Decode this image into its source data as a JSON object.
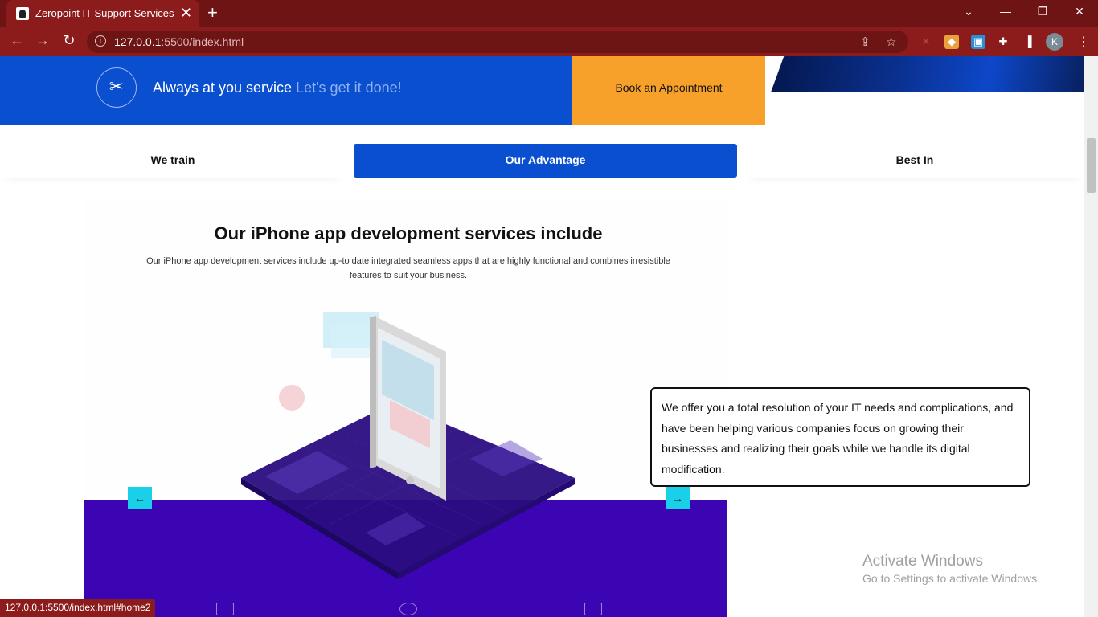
{
  "browser": {
    "tab_title": "Zeropoint IT Support Services",
    "tab_close": "✕",
    "new_tab": "+",
    "url_host": "127.0.0.1",
    "url_rest": ":5500/index.html",
    "status_url": "127.0.0.1:5500/index.html#home2",
    "profile_initial": "K"
  },
  "header": {
    "service_main": "Always at you service",
    "service_accent": "Let's get it done!",
    "book_label": "Book an Appointment"
  },
  "tabs": {
    "left": "We train",
    "middle": "Our Advantage",
    "right": "Best In"
  },
  "section": {
    "title": "Our iPhone app development services include",
    "description": "Our iPhone app development services include up-to date integrated seamless apps that are highly functional and combines irresistible features to suit your business."
  },
  "info_box": {
    "text": "We offer you a total resolution of your IT needs and complications, and have been helping various companies focus on growing their businesses and realizing their goals while we handle its digital modification."
  },
  "watermark": {
    "line1": "Activate Windows",
    "line2": "Go to Settings to activate Windows."
  },
  "colors": {
    "chrome": "#8c1c1c",
    "primary_blue": "#0a4fd0",
    "orange": "#f7a02a",
    "purple": "#3b05b3",
    "cyan": "#1ad0e8"
  }
}
